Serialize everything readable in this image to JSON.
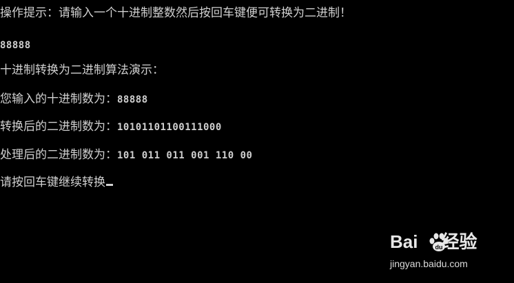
{
  "console": {
    "lines": [
      {
        "label": "操作提示：请输入一个十进制整数然后按回车键便可转换为二进制！",
        "value": ""
      },
      {
        "label": "",
        "value": "88888"
      },
      {
        "label": "十进制转换为二进制算法演示：",
        "value": ""
      },
      {
        "label": "您输入的十进制数为：",
        "value": "88888"
      },
      {
        "label": "转换后的二进制数为：",
        "value": "10101101100111000"
      },
      {
        "label": "处理后的二进制数为：",
        "value": "101 011 011 001 110 00"
      },
      {
        "label": "请按回车键继续转换",
        "value": ""
      }
    ]
  },
  "watermark": {
    "logo_left": "Bai",
    "logo_right": "经验",
    "url": "jingyan.baidu.com"
  },
  "colors": {
    "background": "#000000",
    "text": "#d0d0d0"
  }
}
